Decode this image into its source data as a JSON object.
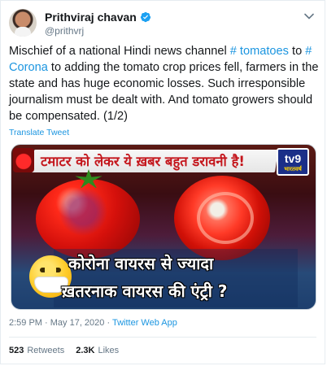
{
  "author": {
    "name": "Prithviraj chavan",
    "handle": "@prithvrj",
    "verified": true
  },
  "tweet": {
    "text_part1": "Mischief of a national Hindi news channel ",
    "hashtag1": "# tomatoes",
    "text_part2": " to ",
    "hashtag2": "# Corona",
    "text_part3": " to adding the tomato crop prices fell, farmers in the state and has huge economic losses. Such irresponsible journalism must be dealt with. And tomato growers should be compensated. (1/2)",
    "translate_label": "Translate Tweet"
  },
  "media": {
    "banner_headline": "टमाटर को लेकर ये ख़बर बहुत डरावनी है!",
    "channel_logo": "tv9",
    "channel_logo_sub": "भारतवर्ष",
    "subtitle_line1": "कोरोना वायरस से ज्यादा",
    "subtitle_line2": "ख़तरनाक वायरस की एंट्री ?"
  },
  "meta": {
    "time": "2:59 PM",
    "separator": " · ",
    "date": "May 17, 2020",
    "source": "Twitter Web App"
  },
  "stats": {
    "retweets_count": "523",
    "retweets_label": "Retweets",
    "likes_count": "2.3K",
    "likes_label": "Likes"
  },
  "colors": {
    "link": "#1b95e0",
    "secondary_text": "#657786",
    "primary_text": "#14171a",
    "verified": "#1da1f2"
  }
}
